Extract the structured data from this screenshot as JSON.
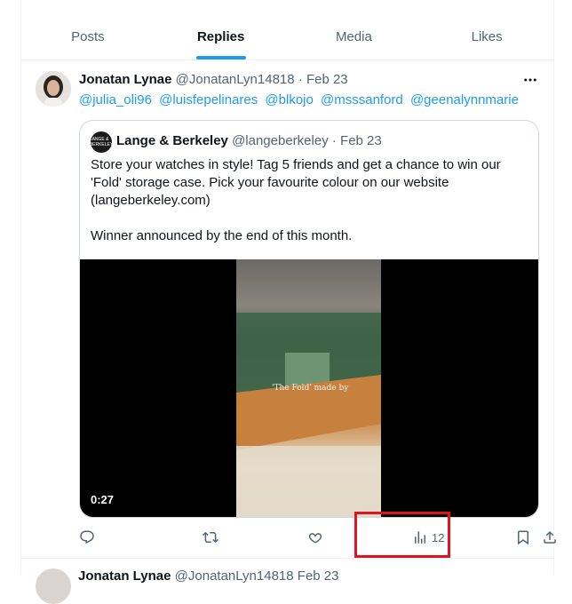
{
  "tabs": [
    {
      "label": "Posts",
      "active": false
    },
    {
      "label": "Replies",
      "active": true
    },
    {
      "label": "Media",
      "active": false
    },
    {
      "label": "Likes",
      "active": false
    }
  ],
  "tweet": {
    "author_name": "Jonatan Lynae",
    "author_handle": "@JonatanLyn14818",
    "date": "Feb 23",
    "mentions": [
      "@julia_oli96",
      "@luisfepelinares",
      "@blkojo",
      "@msssanford",
      "@geenalynnmarie"
    ],
    "quote": {
      "avatar_text": "LANGE & BERKELEY",
      "author_name": "Lange & Berkeley",
      "author_handle": "@langeberkeley",
      "date": "Feb 23",
      "text_1": "Store your watches in style! Tag 5 friends and get a chance to win our 'Fold' storage case. Pick your favourite colour on our website (langeberkeley.com)",
      "text_2": "Winner announced by the end of this month.",
      "video_overlay": "'The Fold' made by",
      "video_duration": "0:27"
    },
    "views": "12"
  },
  "next_tweet": {
    "author_name": "Jonatan Lynae",
    "author_handle": "@JonatanLyn14818",
    "date": "Feb 23"
  },
  "colors": {
    "accent": "#1d9bf0",
    "highlight_box": "#e0131f",
    "secondary_text": "#536471"
  }
}
